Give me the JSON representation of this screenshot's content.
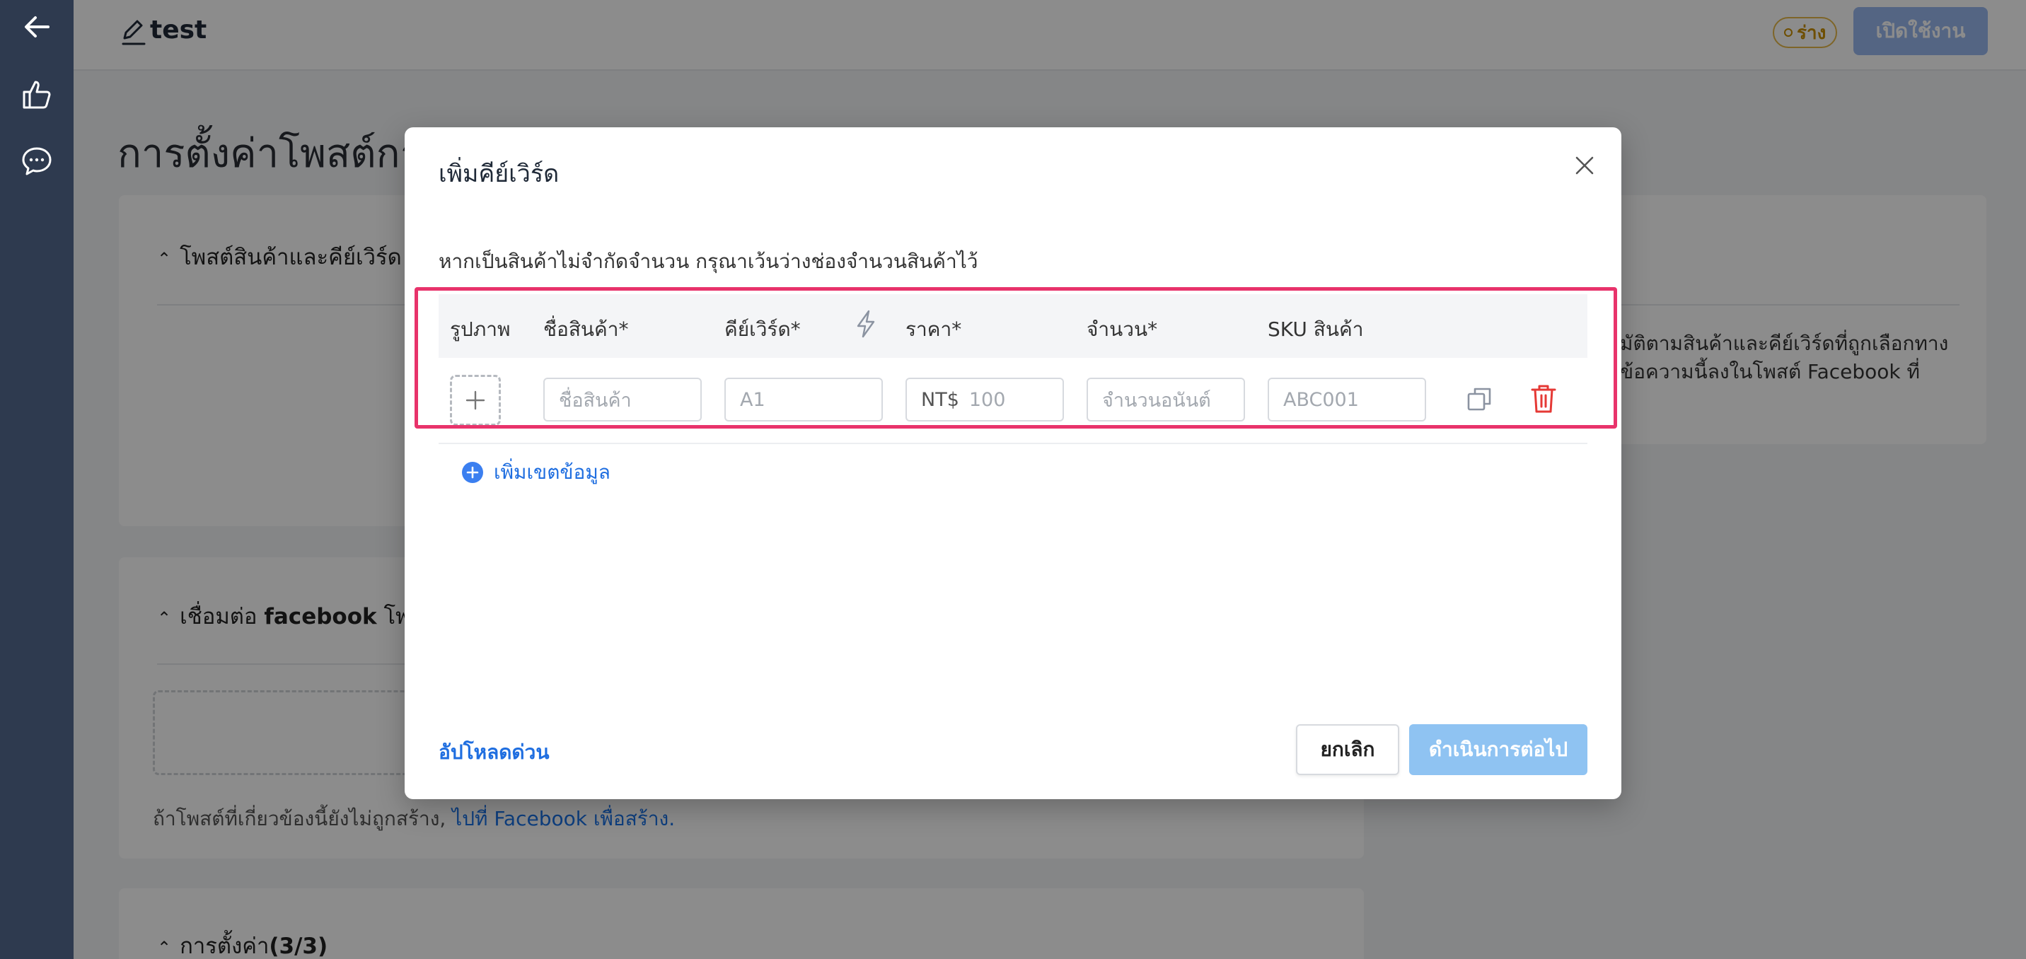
{
  "header": {
    "title": "test",
    "status": "ร่าง",
    "enable_button": "เปิดใช้งาน"
  },
  "page": {
    "title": "การตั้งค่าโพสต์การ",
    "section_products": "โพสต์สินค้าและคีย์เวิร์ด",
    "section_facebook_prefix": "เชื่อมต่อ ",
    "section_facebook_bold": "facebook",
    "section_facebook_suffix": " โพส",
    "section_settings_prefix": "การตั้งค่า",
    "section_settings_count": "(3/3)",
    "right_description": "มัติตามสินค้าและคีย์เวิร์ดที่ถูกเลือกทาง ข้อความนี้ลงในโพสต์ Facebook ที่",
    "footnote_text": "ถ้าโพสต์ที่เกี่ยวข้องนี้ยังไม่ถูกสร้าง, ",
    "footnote_link": "ไปที่ Facebook เพื่อสร้าง."
  },
  "modal": {
    "title": "เพิ่มคีย์เวิร์ด",
    "hint": "หากเป็นสินค้าไม่จำกัดจำนวน กรุณาเว้นว่างช่องจำนวนสินค้าไว้",
    "columns": {
      "image": "รูปภาพ",
      "name": "ชื่อสินค้า*",
      "keyword": "คีย์เวิร์ด*",
      "price": "ราคา*",
      "quantity": "จำนวน*",
      "sku": "SKU สินค้า"
    },
    "row": {
      "name_placeholder": "ชื่อสินค้า",
      "keyword_placeholder": "A1",
      "price_prefix": "NT$",
      "price_placeholder": "100",
      "quantity_placeholder": "จำนวนอนันต์",
      "sku_placeholder": "ABC001"
    },
    "add_row_label": "เพิ่มเขตข้อมูล",
    "upload_link": "อัปโหลดด่วน",
    "cancel_button": "ยกเลิก",
    "proceed_button": "ดำเนินการต่อไป"
  },
  "colors": {
    "nav_bg": "#2e3a4f",
    "highlight": "#e8336b",
    "link": "#1f6ee0",
    "danger": "#e53935",
    "proceed_disabled": "#8fc3f2"
  },
  "icons": [
    "back-arrow-icon",
    "thumbs-up-icon",
    "chat-icon",
    "edit-icon",
    "close-icon",
    "bolt-icon",
    "plus-icon",
    "copy-icon",
    "trash-icon",
    "plus-circle-icon"
  ]
}
